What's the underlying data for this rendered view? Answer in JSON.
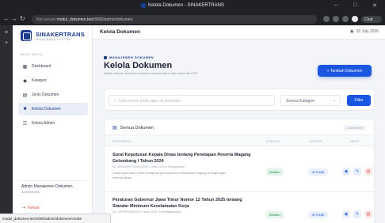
{
  "browser": {
    "tab_title": "Kelola Dokumen - SINAKERTRANS",
    "url_security": "Not secure",
    "url_host": "modul_dokumen.test",
    "url_path": ":8080/admin/dokumen",
    "chat_label": "Chat",
    "status_url": "modul_dokumen.test:8080/admin/dokumen/create"
  },
  "sidebar": {
    "brand_name": "SINAKERTRANS",
    "brand_sub": "MANAJEMEN SYSTEM",
    "menu_heading": "MENU MODUL",
    "items": [
      {
        "label": "Dashboard",
        "icon": "grid-icon",
        "active": false
      },
      {
        "label": "Kategori",
        "icon": "tag-icon",
        "active": false
      },
      {
        "label": "Jenis Dokumen",
        "icon": "file-icon",
        "active": false
      },
      {
        "label": "Kelola Dokumen",
        "icon": "folder-icon",
        "active": true
      },
      {
        "label": "Kelola Admin",
        "icon": "users-icon",
        "active": false
      }
    ],
    "admin_name": "Admin Manajemen Dokumen",
    "admin_role": "Administrator",
    "logout_label": "Keluar"
  },
  "topbar": {
    "title": "Kelola Dokumen",
    "date": "02 July 2026"
  },
  "page": {
    "eyebrow": "MANAJEMEN DOKUMEN",
    "title": "Kelola Dokumen",
    "description": "Daftar seluruh dokumen instansi beserta status dan akses file PDF",
    "add_button": "+ Tambah Dokumen"
  },
  "filter": {
    "search_placeholder": "Cari nomor, judul, atau isi dokumen",
    "category_selected": "Semua Kategori",
    "filter_button": "Filter"
  },
  "table": {
    "title": "Semua Dokumen",
    "count": "4 dokumen",
    "headers": {
      "doc": "DOKUMEN",
      "status": "STATUS",
      "access": "AKSES",
      "action": "AKSI"
    },
    "rows": [
      {
        "title": "Surat Keputusan Kepala Dinas tentang Penetapan Peserta Magang Gelombang I Tahun 2024",
        "meta": "No. 050/SK/KPTS/DK/1/2024 • Tahun 2024 • Kepegawaian",
        "desc": "Surat keputusan resmi mengenai penempatan mahasiswa magang di lingkungan internal dinas.",
        "status": "Berlaku",
        "access": "Publik"
      },
      {
        "title": "Peraturan Gubernur Jawa Timur Nomor 12 Tahun 2025 tentang Standar Minimum Keselamatan Kerja",
        "meta": "No. 12/PERGUB/2025 • Tahun 2025 • Ketenagakerjaan",
        "desc": "",
        "status": "Berlaku",
        "access": "Publik"
      }
    ]
  },
  "colors": {
    "primary": "#1a3d8f",
    "accent": "#1a56e0",
    "success": "#1c8a4a",
    "danger": "#e05252"
  }
}
